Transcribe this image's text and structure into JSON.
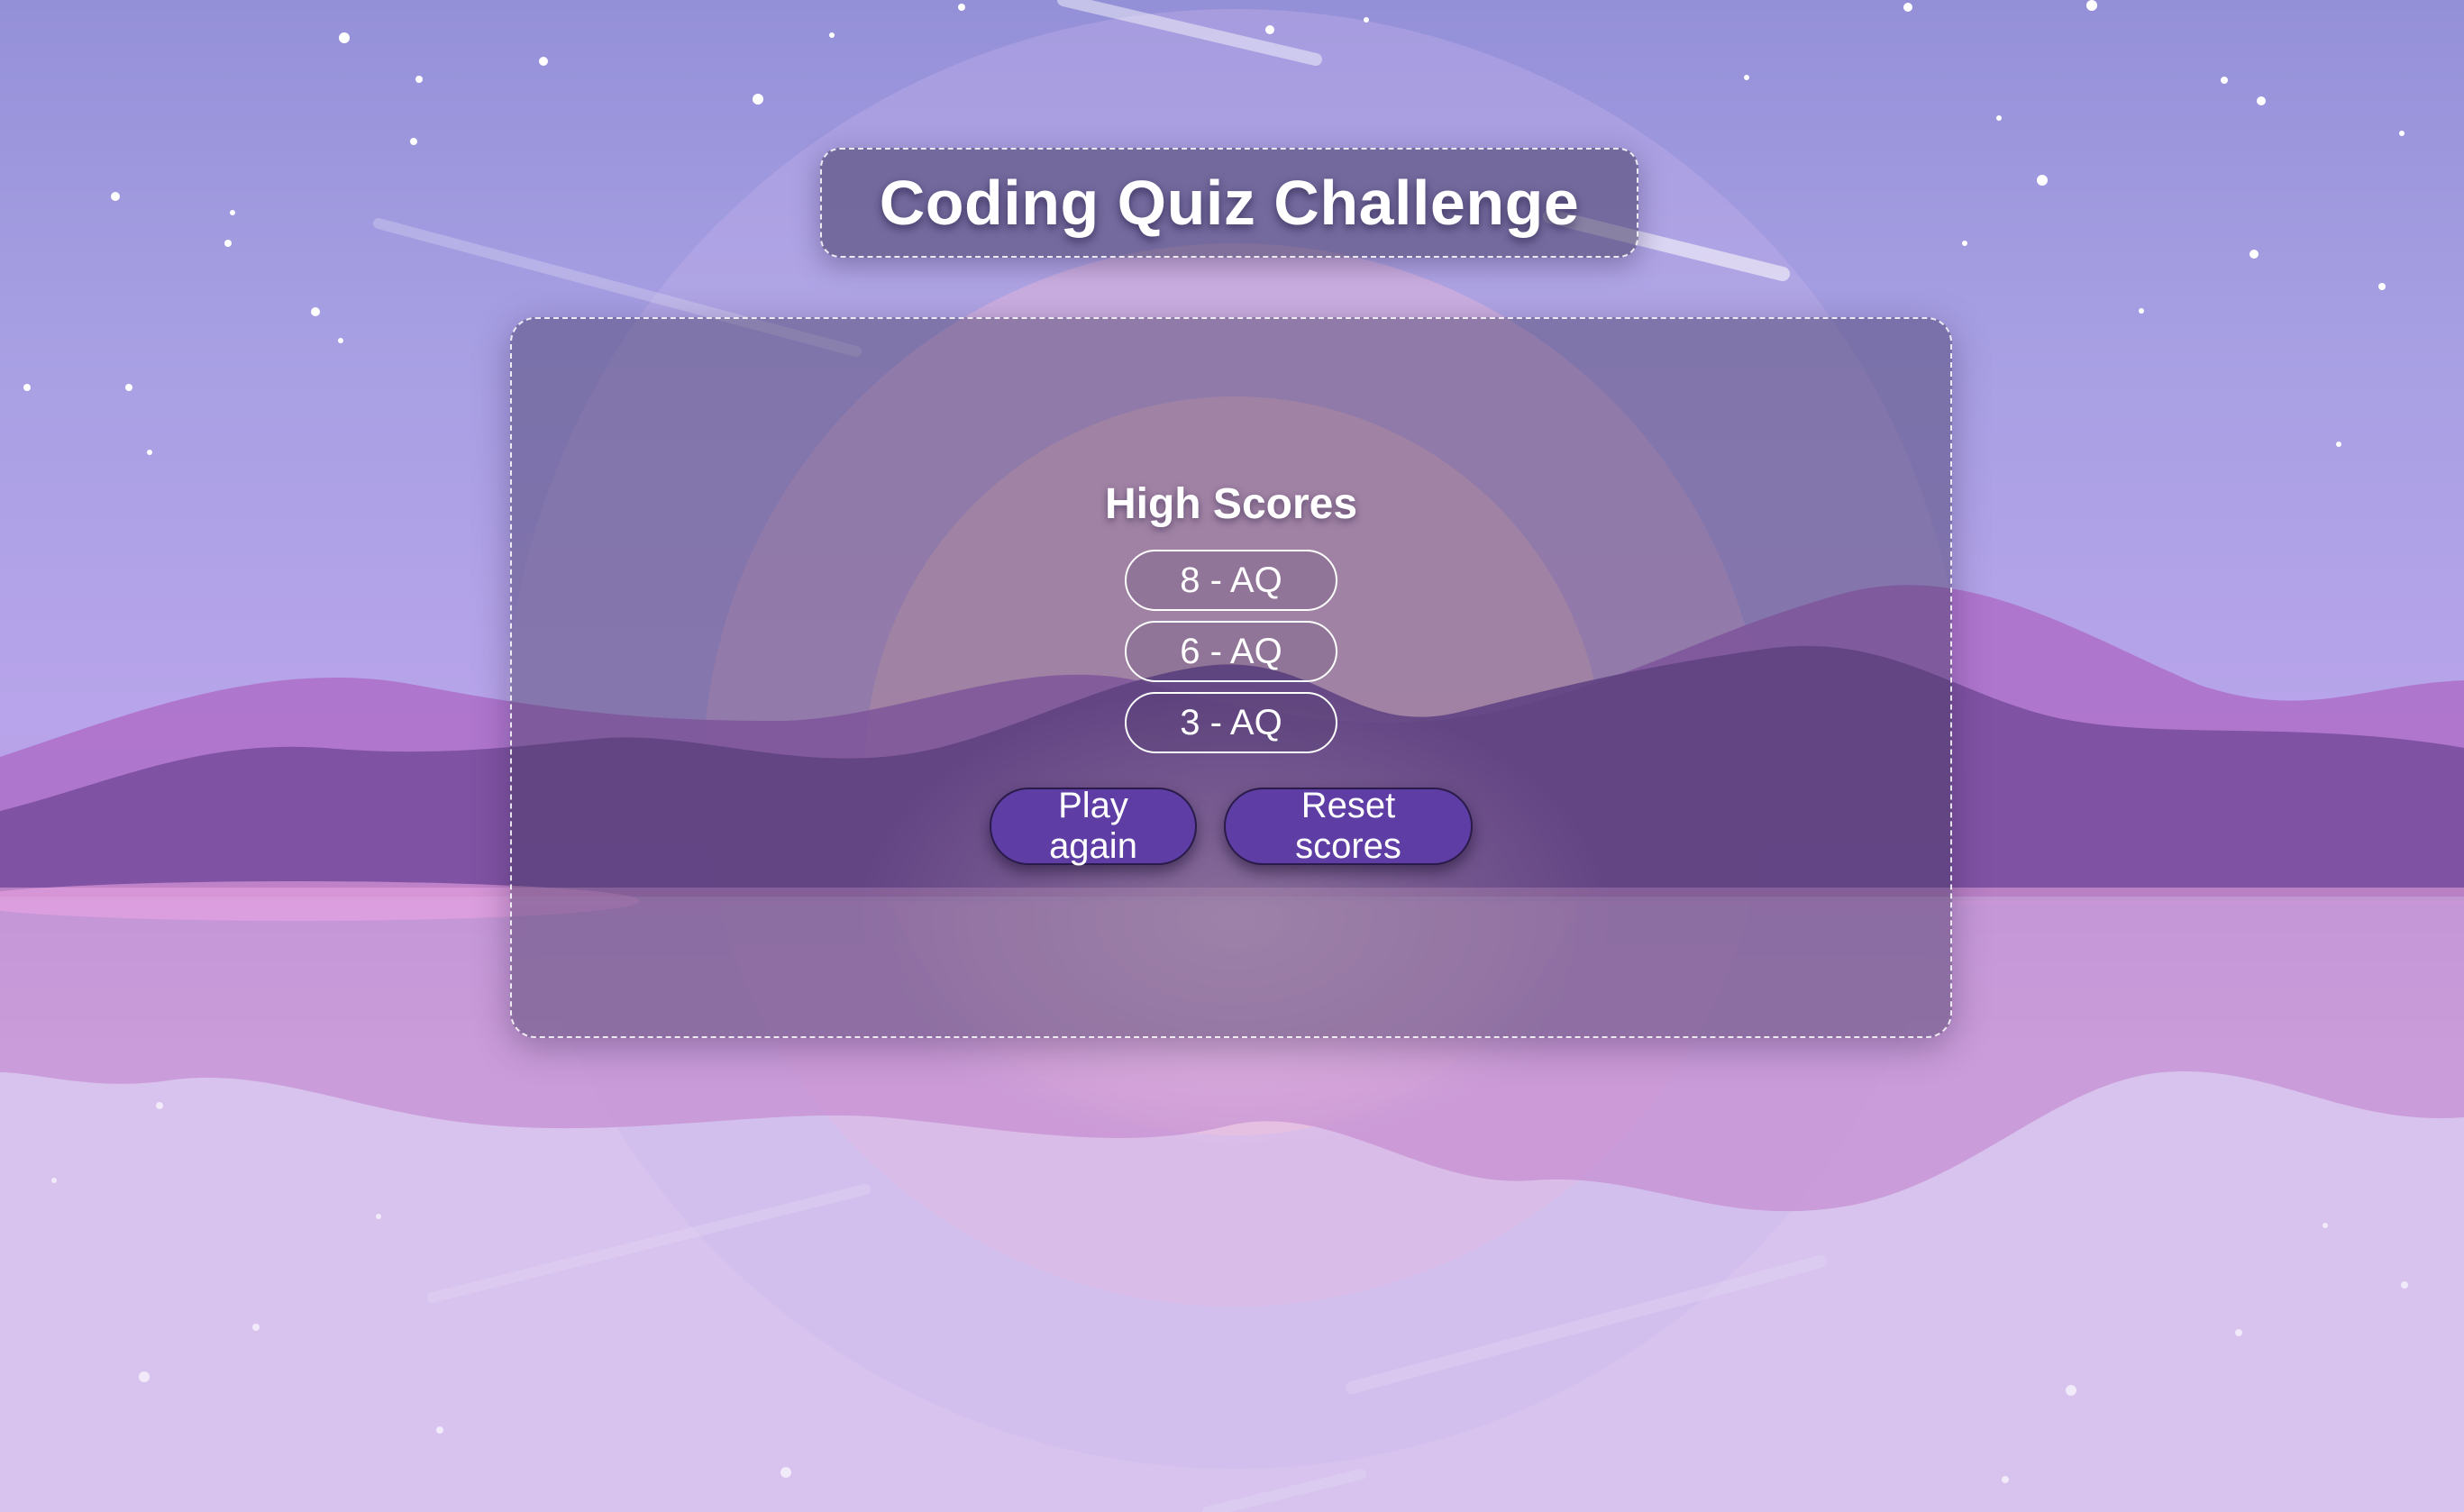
{
  "header": {
    "title": "Coding Quiz Challenge"
  },
  "highscores": {
    "heading": "High Scores",
    "entries": [
      {
        "label": "8 - AQ"
      },
      {
        "label": "6 - AQ"
      },
      {
        "label": "3 - AQ"
      }
    ]
  },
  "actions": {
    "play_again_label": "Play again",
    "reset_scores_label": "Reset scores"
  },
  "colors": {
    "sky_top": "#9490d8",
    "button_fill": "#5e3ea5",
    "mountain_back": "#a970c8",
    "mountain_front": "#7a4f9c",
    "sun_glow": "#e8b8e8"
  }
}
